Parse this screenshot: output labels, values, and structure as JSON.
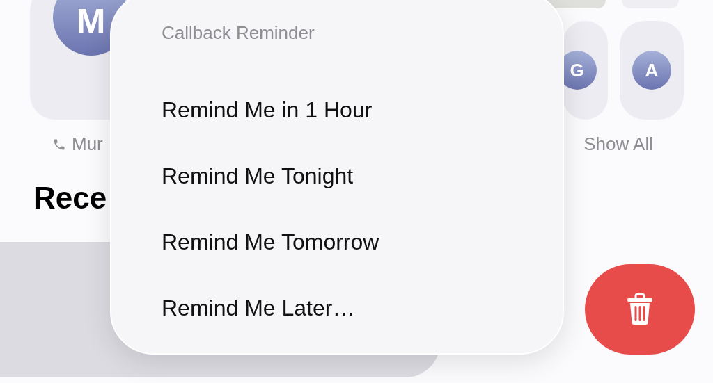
{
  "favorites": {
    "contact": {
      "initial": "M",
      "label": "Mur"
    },
    "shortcuts": [
      {
        "initial": "G"
      },
      {
        "initial": "A"
      }
    ],
    "show_all": "Show All"
  },
  "section_title": "Rece",
  "menu": {
    "title": "Callback Reminder",
    "items": [
      {
        "label": "Remind Me in 1 Hour"
      },
      {
        "label": "Remind Me Tonight"
      },
      {
        "label": "Remind Me Tomorrow"
      },
      {
        "label": "Remind Me Later…"
      }
    ]
  },
  "delete_button": {
    "kind": "trash"
  }
}
